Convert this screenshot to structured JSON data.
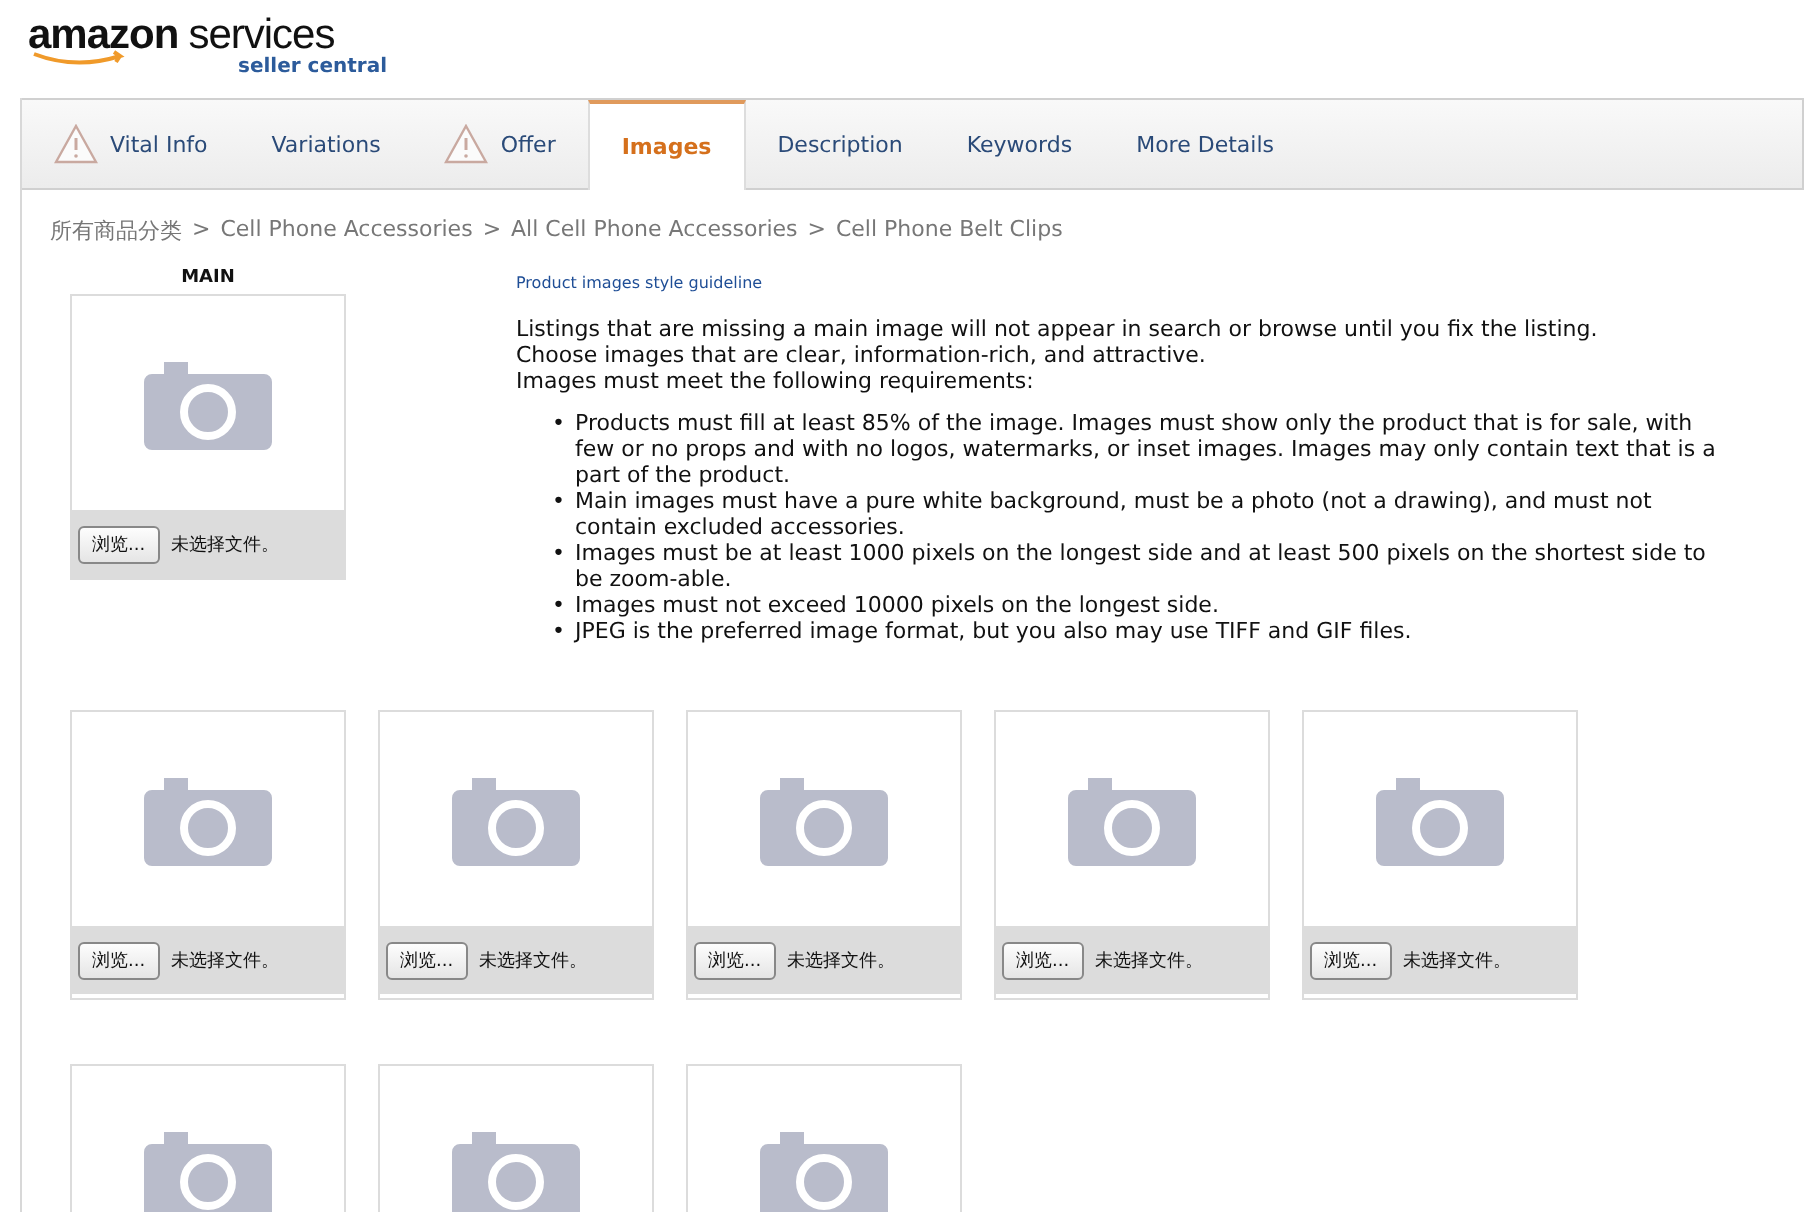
{
  "logo": {
    "brand": "amazon",
    "product": "services",
    "subtitle": "seller central"
  },
  "tabs": [
    {
      "label": "Vital Info",
      "warning": true,
      "selected": false
    },
    {
      "label": "Variations",
      "warning": false,
      "selected": false
    },
    {
      "label": "Offer",
      "warning": true,
      "selected": false
    },
    {
      "label": "Images",
      "warning": false,
      "selected": true
    },
    {
      "label": "Description",
      "warning": false,
      "selected": false
    },
    {
      "label": "Keywords",
      "warning": false,
      "selected": false
    },
    {
      "label": "More Details",
      "warning": false,
      "selected": false
    }
  ],
  "breadcrumb": [
    "所有商品分类",
    "Cell Phone Accessories",
    "All Cell Phone Accessories",
    "Cell Phone Belt Clips"
  ],
  "breadcrumb_separator": ">",
  "main_slot": {
    "title": "MAIN",
    "button": "浏览...",
    "status": "未选择文件。"
  },
  "guideline_link": "Product images style guideline",
  "intro": [
    "Listings that are missing a main image will not appear in search or browse until you fix the listing.",
    "Choose images that are clear, information-rich, and attractive.",
    "Images must meet the following requirements:"
  ],
  "bullet": "•",
  "requirements": [
    "Products must fill at least 85% of the image. Images must show only the product that is for sale, with few or no props and with no logos, watermarks, or inset images. Images may only contain text that is a part of the product.",
    "Main images must have a pure white background, must be a photo (not a drawing), and must not contain excluded accessories.",
    "Images must be at least 1000 pixels on the longest side and at least 500 pixels on the shortest side to be zoom-able.",
    "Images must not exceed 10000 pixels on the longest side.",
    "JPEG is the preferred image format, but you also may use TIFF and GIF files."
  ],
  "slot_rows": [
    [
      {
        "button": "浏览...",
        "status": "未选择文件。"
      },
      {
        "button": "浏览...",
        "status": "未选择文件。"
      },
      {
        "button": "浏览...",
        "status": "未选择文件。"
      },
      {
        "button": "浏览...",
        "status": "未选择文件。"
      },
      {
        "button": "浏览...",
        "status": "未选择文件。"
      }
    ],
    [
      {},
      {},
      {}
    ]
  ]
}
